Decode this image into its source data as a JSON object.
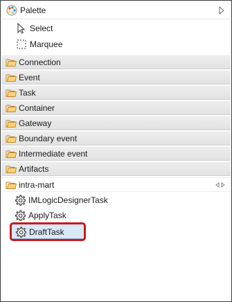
{
  "palette": {
    "title": "Palette",
    "tools": [
      {
        "label": "Select",
        "icon": "arrow-pointer-icon"
      },
      {
        "label": "Marquee",
        "icon": "marquee-icon"
      }
    ],
    "drawers": [
      {
        "label": "Connection",
        "open": false
      },
      {
        "label": "Event",
        "open": false
      },
      {
        "label": "Task",
        "open": false
      },
      {
        "label": "Container",
        "open": false
      },
      {
        "label": "Gateway",
        "open": false
      },
      {
        "label": "Boundary event",
        "open": false
      },
      {
        "label": "Intermediate event",
        "open": false
      },
      {
        "label": "Artifacts",
        "open": false
      },
      {
        "label": "intra-mart",
        "open": true
      }
    ],
    "intra_mart_items": [
      {
        "label": "IMLogicDesignerTask",
        "icon": "gear-icon"
      },
      {
        "label": "ApplyTask",
        "icon": "gear-icon"
      },
      {
        "label": "DraftTask",
        "icon": "gear-icon",
        "selected": true
      }
    ]
  },
  "colors": {
    "highlight": "#c8191d",
    "selection": "#dbe8f8",
    "drawer": "#e8e8e8",
    "folder": "#e8a33d"
  }
}
